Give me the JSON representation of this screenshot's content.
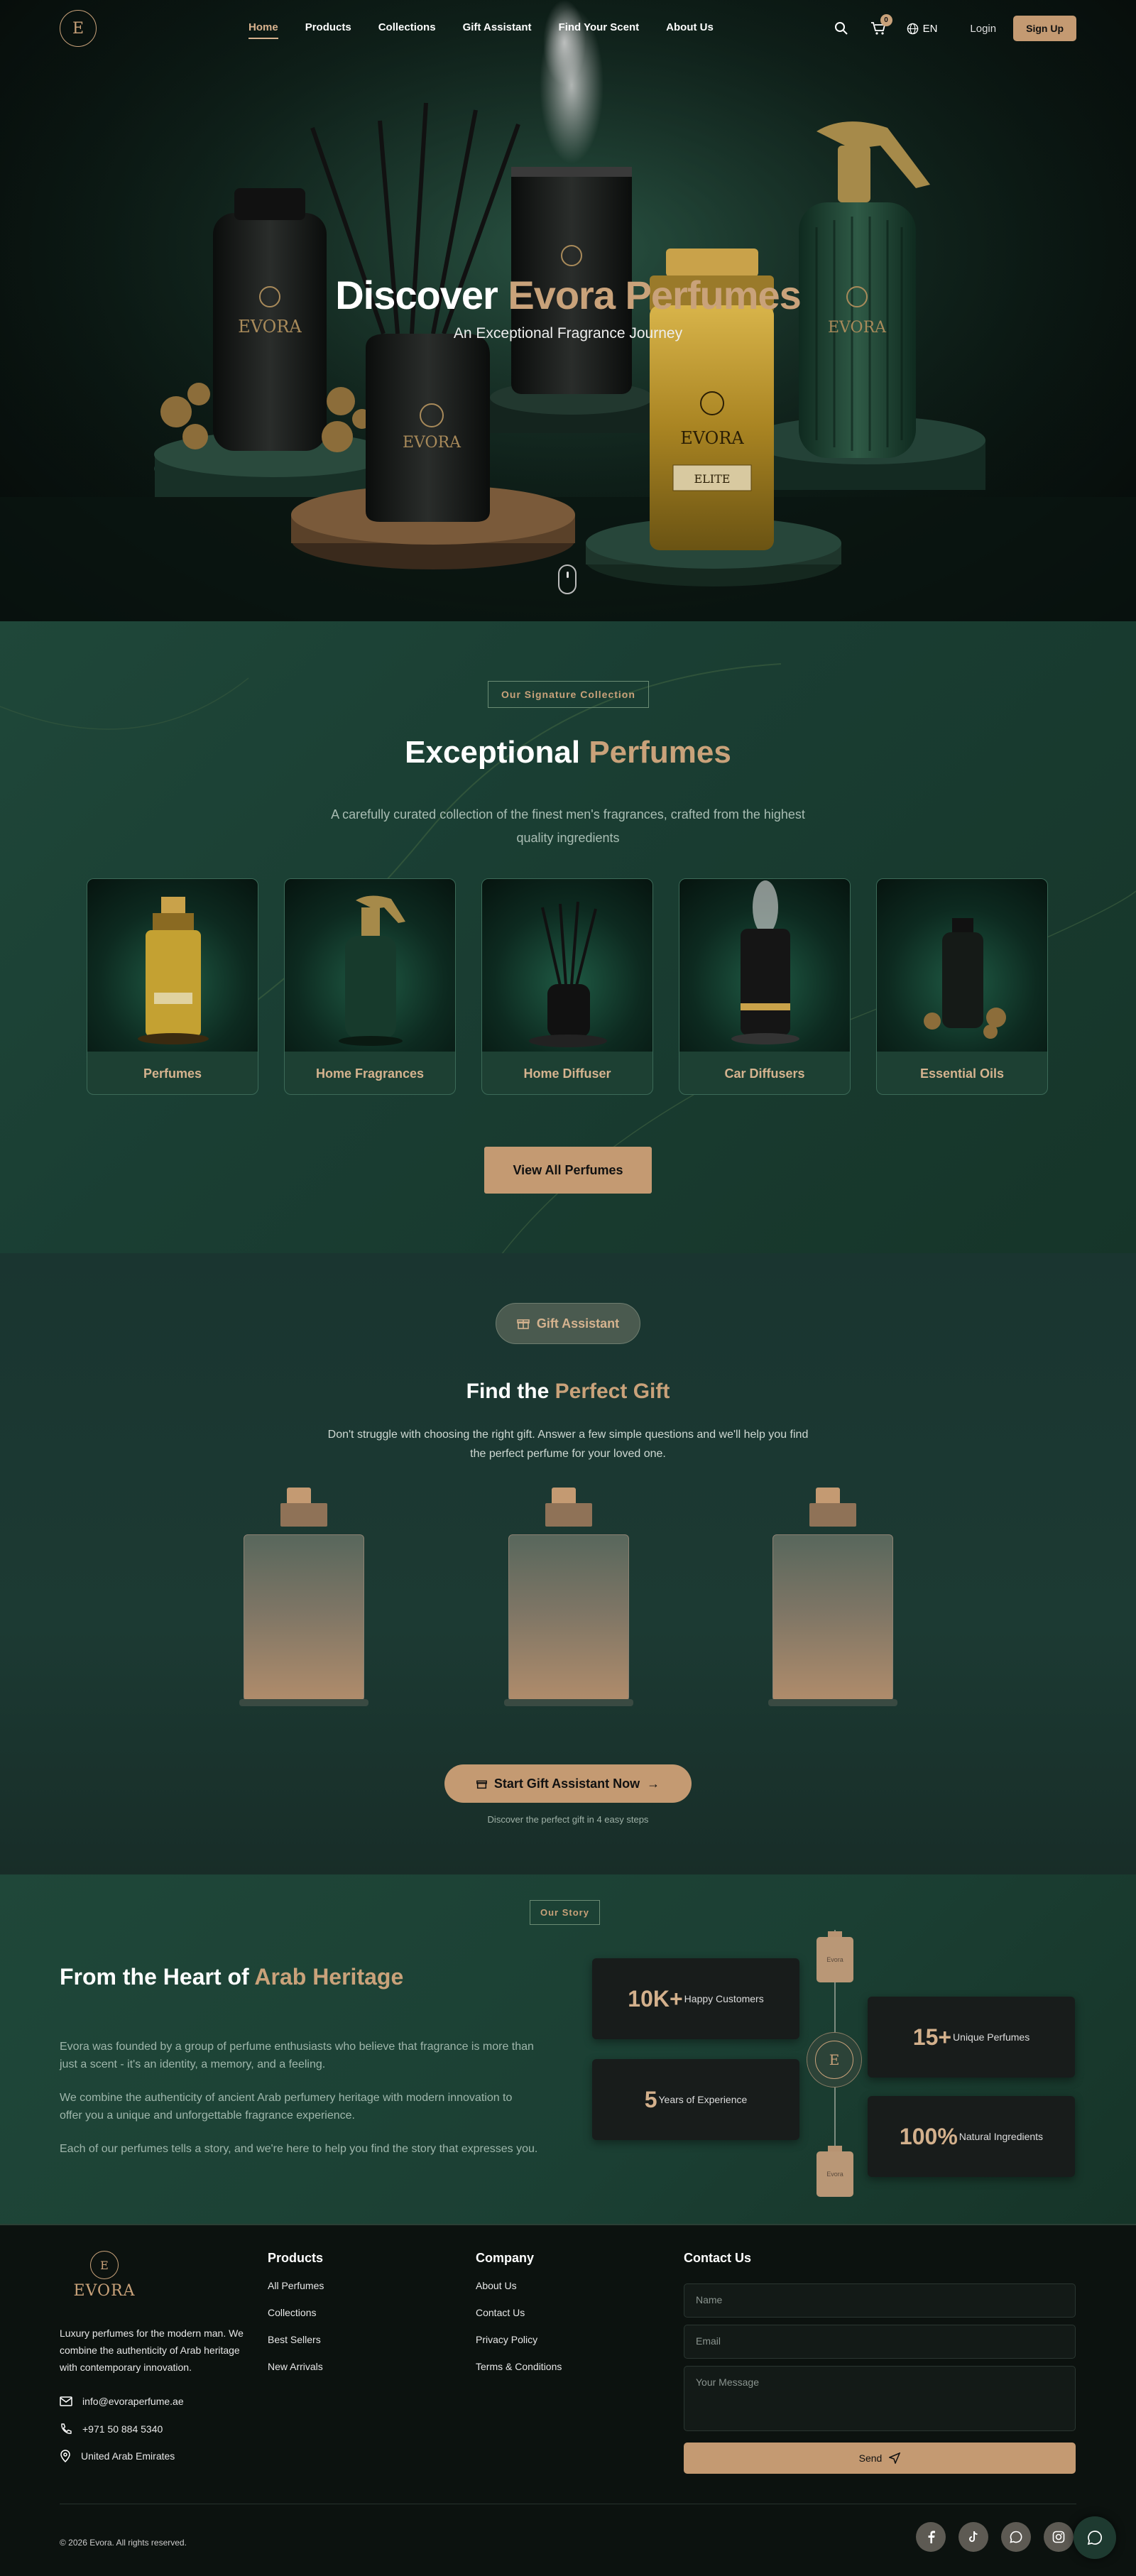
{
  "nav": {
    "logo_letter": "E",
    "links": [
      "Home",
      "Products",
      "Collections",
      "Gift Assistant",
      "Find Your Scent",
      "About Us"
    ],
    "cart_count": "0",
    "lang": "EN",
    "login": "Login",
    "signup": "Sign Up"
  },
  "hero": {
    "title_white": "Discover",
    "title_gold": "Evora Perfumes",
    "subtitle": "An Exceptional Fragrance Journey",
    "bottle_brand": "EVORA",
    "bottle_label": "ELITE"
  },
  "signature": {
    "label": "Our Signature Collection",
    "title_white": "Exceptional",
    "title_gold": "Perfumes",
    "description_line1": "A carefully curated collection of the finest men's fragrances, crafted from the highest",
    "description_line2": "quality ingredients",
    "categories": [
      "Perfumes",
      "Home Fragrances",
      "Home Diffuser",
      "Car Diffusers",
      "Essential Oils"
    ],
    "view_all": "View All Perfumes"
  },
  "gift": {
    "pill": "Gift Assistant",
    "title_white": "Find the",
    "title_gold": "Perfect Gift",
    "description_line1": "Don't struggle with choosing the right gift. Answer a few simple questions and we'll help you find",
    "description_line2": "the perfect perfume for your loved one.",
    "button": "Start Gift Assistant Now",
    "note": "Discover the perfect gift in 4 easy steps"
  },
  "story": {
    "label": "Our Story",
    "title_white": "From the Heart of",
    "title_gold": "Arab Heritage",
    "p1_line1": "Evora was founded by a group of perfume enthusiasts who believe that fragrance is more than",
    "p1_line2": "just a scent - it's an identity, a memory, and a feeling.",
    "p2_line1": "We combine the authenticity of ancient Arab perfumery heritage with modern innovation to",
    "p2_line2": "offer you a unique and unforgettable fragrance experience.",
    "p3": "Each of our perfumes tells a story, and we're here to help you find the story that expresses you.",
    "stats": [
      {
        "num": "10K+",
        "label": "Happy Customers"
      },
      {
        "num": "5",
        "label": "Years of Experience"
      },
      {
        "num": "15+",
        "label": "Unique Perfumes"
      },
      {
        "num": "100%",
        "label": "Natural Ingredients"
      }
    ],
    "mini_top": "Evora",
    "mini_bottom": "Evora",
    "node_letter": "E"
  },
  "footer": {
    "logo_letter": "E",
    "logo_word": "EVORA",
    "desc": "Luxury perfumes for the modern man. We combine the authenticity of Arab heritage with contemporary innovation.",
    "email": "info@evoraperfume.ae",
    "phone": "+971 50 884 5340",
    "location": "United Arab Emirates",
    "products_title": "Products",
    "products": [
      "All Perfumes",
      "Collections",
      "Best Sellers",
      "New Arrivals"
    ],
    "company_title": "Company",
    "company": [
      "About Us",
      "Contact Us",
      "Privacy Policy",
      "Terms & Conditions"
    ],
    "contact_title": "Contact Us",
    "name_ph": "Name",
    "email_ph": "Email",
    "message_ph": "Your Message",
    "send": "Send",
    "copyright": "© 2026 Evora. All rights reserved."
  }
}
